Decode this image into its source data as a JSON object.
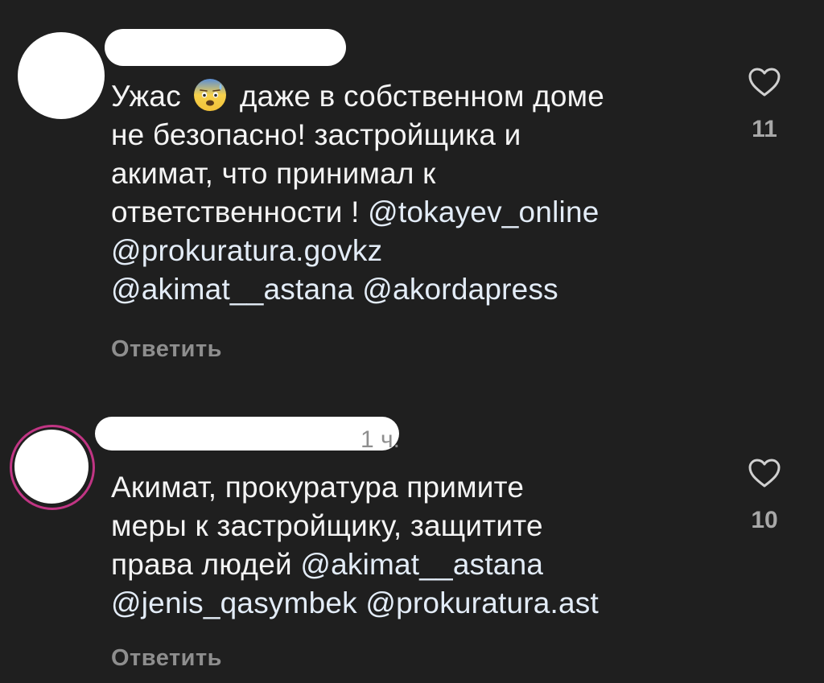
{
  "comments": [
    {
      "lines": [
        {
          "before": "Ужас",
          "emoji": "anxious-face-with-sweat",
          "after": "даже в собственном доме"
        },
        {
          "text": "не безопасно! застройщика и"
        },
        {
          "text": "акимат, что принимал к"
        },
        {
          "text": "ответственности !",
          "mention": "@tokayev_online"
        },
        {
          "mention": "@prokuratura.govkz"
        },
        {
          "mention": "@akimat__astana",
          "mention2": "@akordapress"
        }
      ],
      "reply_label": "Ответить",
      "like_icon": "heart-outline-icon",
      "like_count": "11"
    },
    {
      "time": "1 ч.",
      "lines": [
        {
          "text": "Акимат, прокуратура примите"
        },
        {
          "text": "меры к застройщику, защитите"
        },
        {
          "text": "права людей",
          "mention": "@akimat__astana"
        },
        {
          "mention": "@jenis_qasymbek",
          "mention2": "@prokuratura.ast"
        }
      ],
      "reply_label": "Ответить",
      "like_icon": "heart-outline-icon",
      "like_count": "10"
    }
  ],
  "colors": {
    "background": "#1f1f1f",
    "text": "#f4f4f4",
    "muted": "#8e8e8e",
    "story_ring": "#c13584"
  }
}
